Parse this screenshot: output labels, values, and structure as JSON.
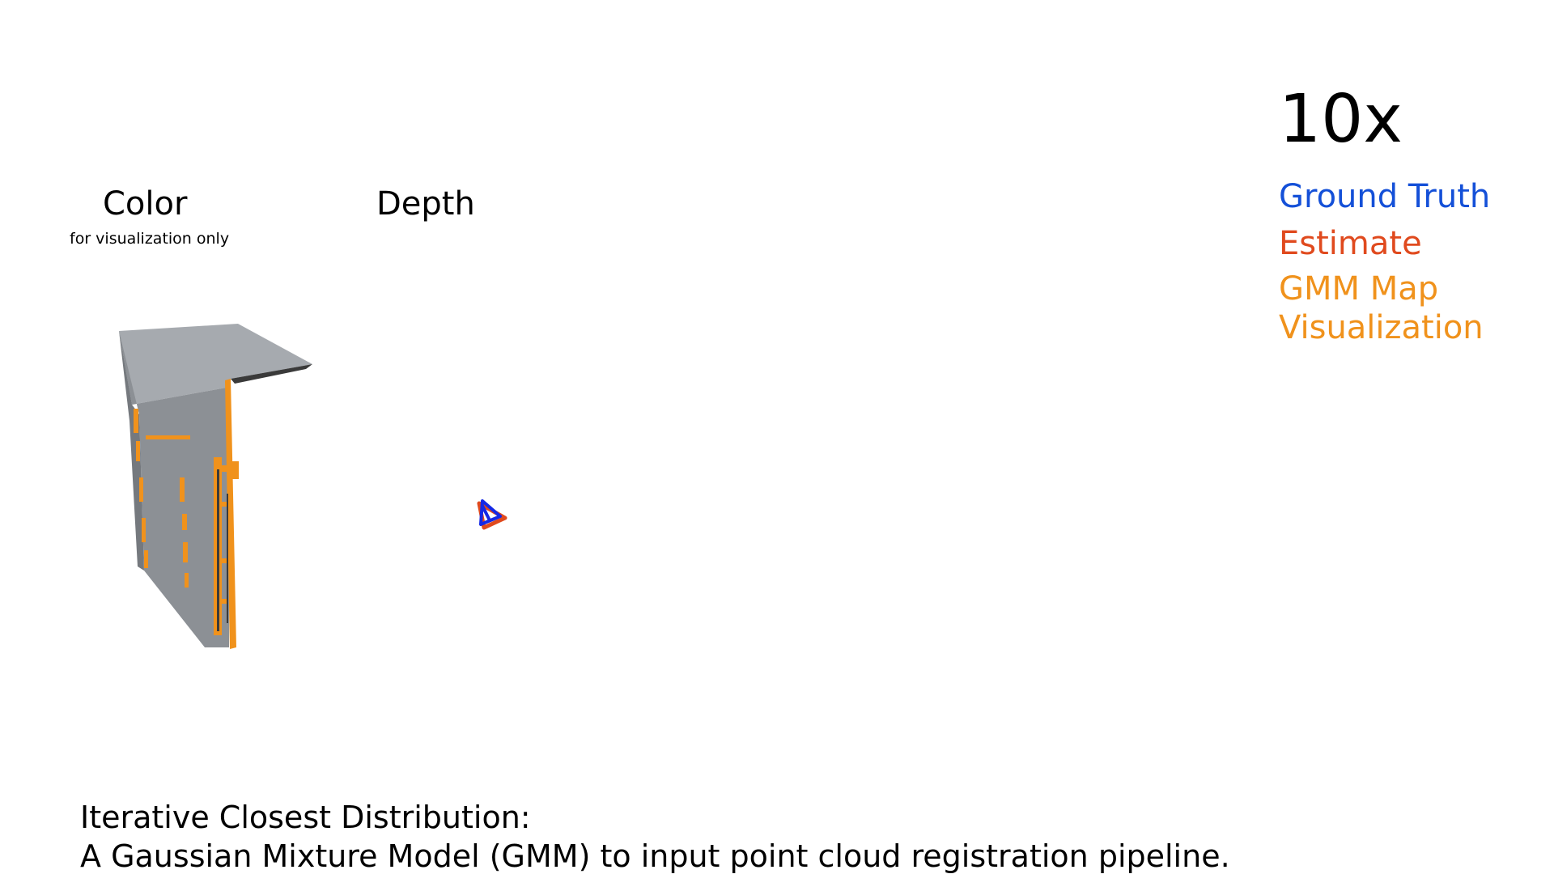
{
  "panels": {
    "color": {
      "title": "Color",
      "subtitle": "for visualization only"
    },
    "depth": {
      "title": "Depth"
    }
  },
  "speed": "10x",
  "legend": {
    "ground_truth": {
      "label": "Ground Truth",
      "color": "#1450d8"
    },
    "estimate": {
      "label": "Estimate",
      "color": "#e04a1e"
    },
    "gmm_map_line1": {
      "label": "GMM Map",
      "color": "#f0921c"
    },
    "gmm_map_line2": {
      "label": "Visualization",
      "color": "#f0921c"
    }
  },
  "caption": {
    "line1": "Iterative Closest Distribution:",
    "line2": "A Gaussian Mixture Model (GMM) to input point cloud registration pipeline."
  },
  "scene": {
    "map_surface_color": "#8c9095",
    "gmm_accent_color": "#f0921c"
  }
}
